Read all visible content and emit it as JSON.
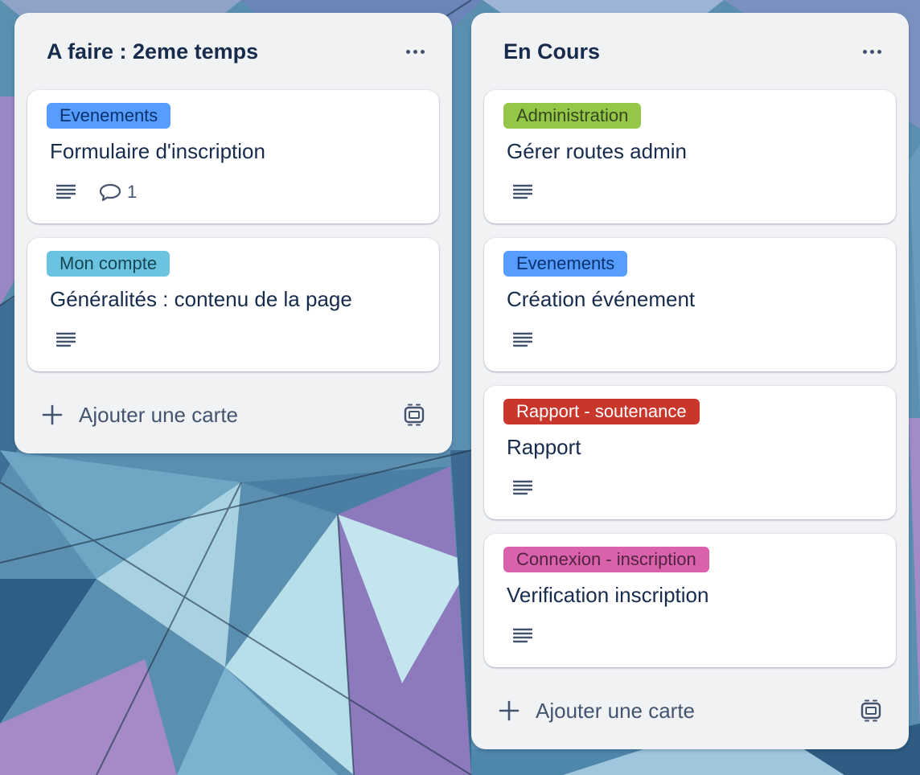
{
  "board": {
    "colors": {
      "list_bg": "#f1f2f4",
      "card_bg": "#ffffff",
      "text": "#172b4d",
      "subtle_text": "#44546f"
    },
    "columns": [
      {
        "title": "A faire : 2eme temps",
        "menu_icon": "more-horizontal-icon",
        "add_card_label": "Ajouter une carte",
        "cards": [
          {
            "label": "Evenements",
            "label_color": "#579dff",
            "label_text_color": "#09326c",
            "title": "Formulaire d'inscription",
            "has_description": true,
            "comments": "1"
          },
          {
            "label": "Mon compte",
            "label_color": "#6cc3e0",
            "label_text_color": "#164555",
            "title": "Généralités : contenu de la page",
            "has_description": true,
            "comments": null
          }
        ]
      },
      {
        "title": "En Cours",
        "menu_icon": "more-horizontal-icon",
        "add_card_label": "Ajouter une carte",
        "cards": [
          {
            "label": "Administration",
            "label_color": "#94c748",
            "label_text_color": "#37471f",
            "title": "Gérer routes admin",
            "has_description": true,
            "comments": null
          },
          {
            "label": "Evenements",
            "label_color": "#579dff",
            "label_text_color": "#09326c",
            "title": "Création événement",
            "has_description": true,
            "comments": null
          },
          {
            "label": "Rapport - soutenance",
            "label_color": "#c9372c",
            "label_text_color": "#ffffff",
            "title": "Rapport",
            "has_description": true,
            "comments": null
          },
          {
            "label": "Connexion - inscription",
            "label_color": "#da62ac",
            "label_text_color": "#50253f",
            "title": "Verification inscription",
            "has_description": true,
            "comments": null
          }
        ]
      }
    ]
  }
}
